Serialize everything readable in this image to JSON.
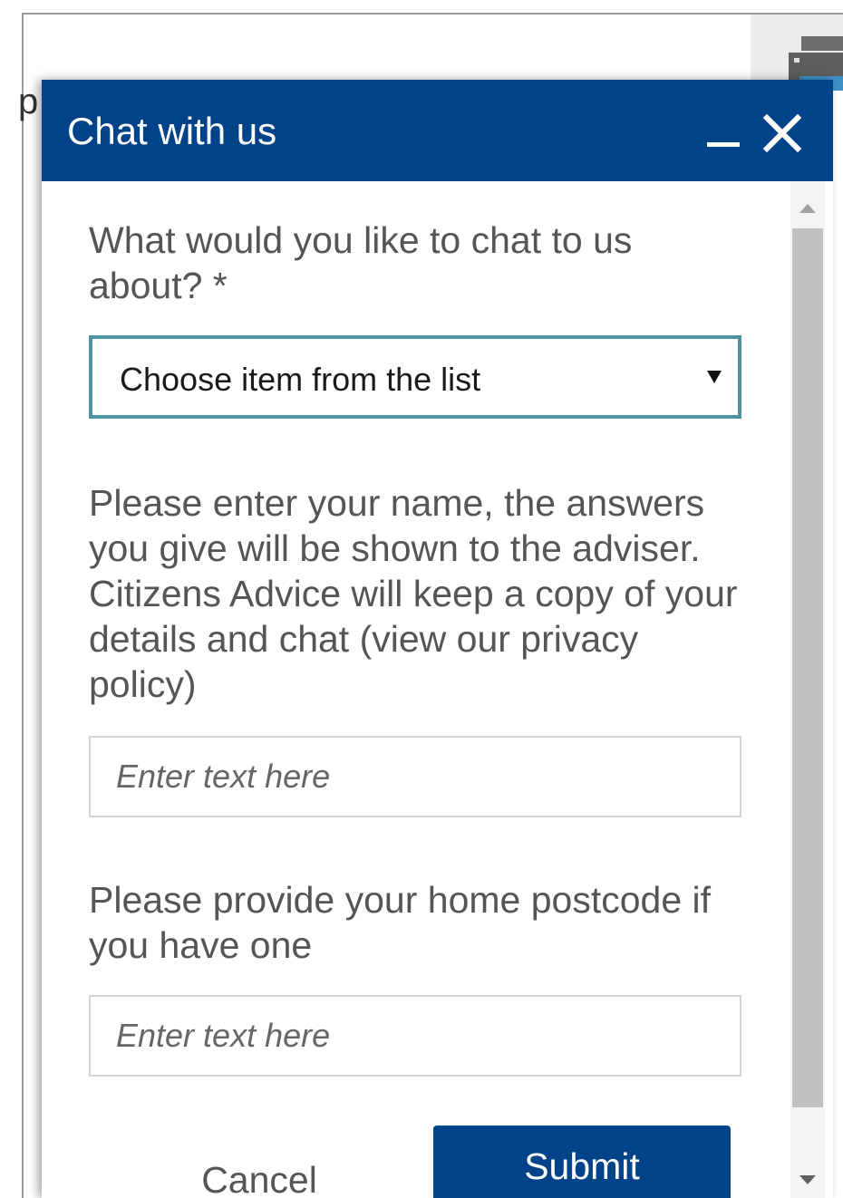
{
  "background": {
    "stray_char": "p"
  },
  "chat": {
    "title": "Chat with us",
    "accent_color": "#014389",
    "topic": {
      "label": "What would you like to chat to us about? *",
      "selected": "Choose item from the list"
    },
    "name": {
      "label": "Please enter your name, the answers you give will be shown to the adviser. Citizens Advice will keep a copy of your details and chat (view our privacy policy)",
      "placeholder": "Enter text here"
    },
    "postcode": {
      "label": "Please provide your home postcode if you have one",
      "placeholder": "Enter text here"
    },
    "cancel_label": "Cancel",
    "submit_label": "Submit"
  },
  "icons": {
    "minimize": "minimize-icon",
    "close": "close-icon",
    "dropdown": "triangle-down-icon",
    "printer": "printer-icon"
  }
}
